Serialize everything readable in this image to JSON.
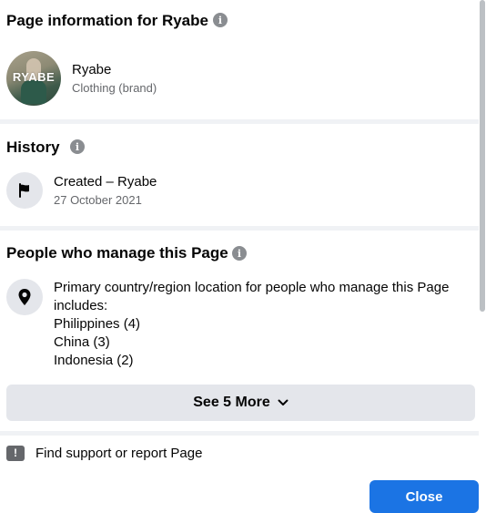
{
  "page_info": {
    "title": "Page information for Ryabe",
    "name": "Ryabe",
    "category": "Clothing (brand)",
    "avatar_text": "RYABE"
  },
  "history": {
    "title": "History",
    "event": "Created – Ryabe",
    "date": "27 October 2021"
  },
  "managers": {
    "title": "People who manage this Page",
    "description_line1": "Primary country/region location for people who manage this Page",
    "description_line2": "includes:",
    "locations": [
      "Philippines (4)",
      "China (3)",
      "Indonesia (2)"
    ],
    "see_more_label": "See 5 More"
  },
  "support": {
    "label": "Find support or report Page"
  },
  "footer": {
    "close_label": "Close"
  },
  "icons": {
    "info": "info-icon",
    "flag": "flag-icon",
    "location": "location-pin-icon",
    "warning": "warning-icon",
    "chevron": "chevron-down-icon"
  },
  "colors": {
    "primary_button": "#1b74e4",
    "secondary_button": "#e4e6eb",
    "secondary_text": "#65676b",
    "divider": "#f0f2f5"
  }
}
